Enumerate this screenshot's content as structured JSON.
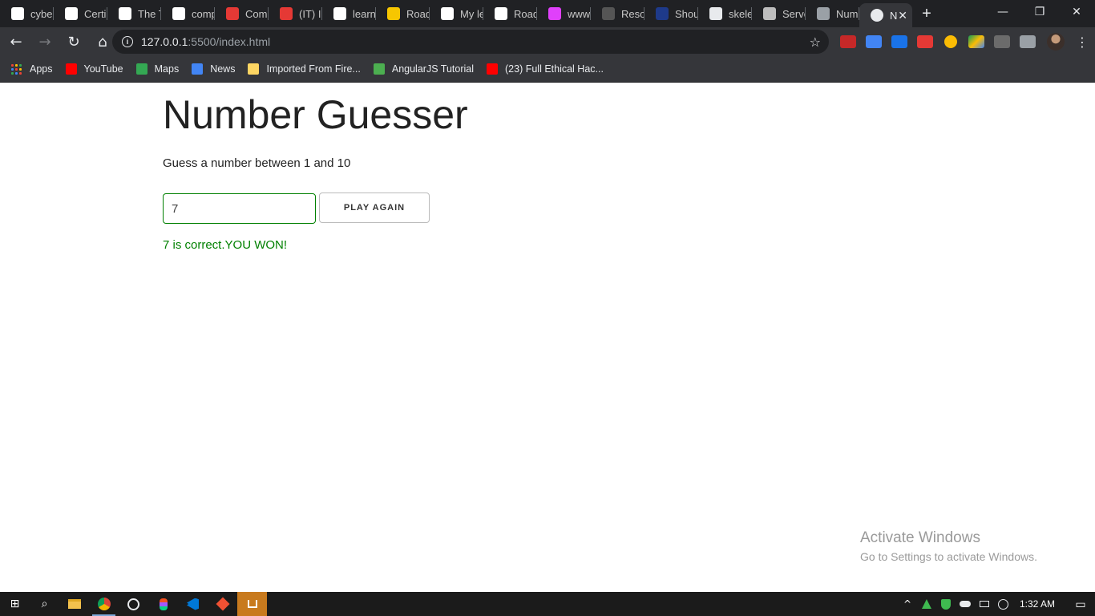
{
  "browser": {
    "tabs": [
      {
        "title": "cyber",
        "icon": "google-icon",
        "color": "#ffffff"
      },
      {
        "title": "Certi",
        "icon": "site-icon",
        "color": "#ffffff"
      },
      {
        "title": "The T",
        "icon": "site-icon",
        "color": "#ffffff"
      },
      {
        "title": "comp",
        "icon": "google-icon",
        "color": "#ffffff"
      },
      {
        "title": "Com",
        "icon": "c-icon",
        "color": "#e53935"
      },
      {
        "title": "(IT) Ir",
        "icon": "c-icon",
        "color": "#e53935"
      },
      {
        "title": "learn",
        "icon": "google-icon",
        "color": "#ffffff"
      },
      {
        "title": "Road",
        "icon": "road-icon",
        "color": "#f7c600"
      },
      {
        "title": "My le",
        "icon": "medium-icon",
        "color": "#ffffff"
      },
      {
        "title": "Road",
        "icon": "medium-icon",
        "color": "#ffffff"
      },
      {
        "title": "www",
        "icon": "css-icon",
        "color": "#e040fb"
      },
      {
        "title": "Resou",
        "icon": "github-icon",
        "color": "#555555"
      },
      {
        "title": "Shou",
        "icon": "t-icon",
        "color": "#1e3a8a"
      },
      {
        "title": "skele",
        "icon": "code-icon",
        "color": "#e8eaed"
      },
      {
        "title": "Serve",
        "icon": "page-icon",
        "color": "#bdbdbd"
      },
      {
        "title": "Num",
        "icon": "globe-icon",
        "color": "#9aa0a6"
      }
    ],
    "active_tab": {
      "title": "N",
      "icon": "globe-icon",
      "close": "✕"
    },
    "new_tab": "+",
    "window_controls": {
      "minimize": "—",
      "restore": "❐",
      "close": "✕"
    },
    "nav": {
      "back": "←",
      "forward": "→",
      "reload": "↻",
      "home": "⌂"
    },
    "url": {
      "host": "127.0.0.1",
      "path": ":5500/index.html",
      "info": "i",
      "star": "☆"
    },
    "menu": "⋮",
    "bookmarks": [
      {
        "label": "Apps",
        "icon": "apps-grid-icon",
        "color": "#e8eaed"
      },
      {
        "label": "YouTube",
        "icon": "youtube-icon",
        "color": "#ff0000"
      },
      {
        "label": "Maps",
        "icon": "maps-icon",
        "color": "#34a853"
      },
      {
        "label": "News",
        "icon": "news-icon",
        "color": "#4285f4"
      },
      {
        "label": "Imported From Fire...",
        "icon": "folder-icon",
        "color": "#fdd663"
      },
      {
        "label": "AngularJS Tutorial",
        "icon": "tutorial-icon",
        "color": "#4caf50"
      },
      {
        "label": "(23) Full Ethical Hac...",
        "icon": "youtube-icon",
        "color": "#ff0000"
      }
    ]
  },
  "app": {
    "title": "Number Guesser",
    "subtitle": "Guess a number between 1 and 10",
    "input_value": "7",
    "button_label": "PLAY AGAIN",
    "message": "7 is correct.YOU WON!",
    "message_color": "#008000"
  },
  "watermark": {
    "line1": "Activate Windows",
    "line2": "Go to Settings to activate Windows."
  },
  "taskbar": {
    "start": "⊞",
    "search": "⌕",
    "apps": [
      "file-explorer-icon",
      "chrome-icon",
      "figma-icon",
      "figma-icon",
      "vscode-icon",
      "git-icon",
      "downloads-icon"
    ],
    "tray": {
      "chevron": "^",
      "clock": "1:32 AM",
      "notifications": "▭"
    }
  }
}
